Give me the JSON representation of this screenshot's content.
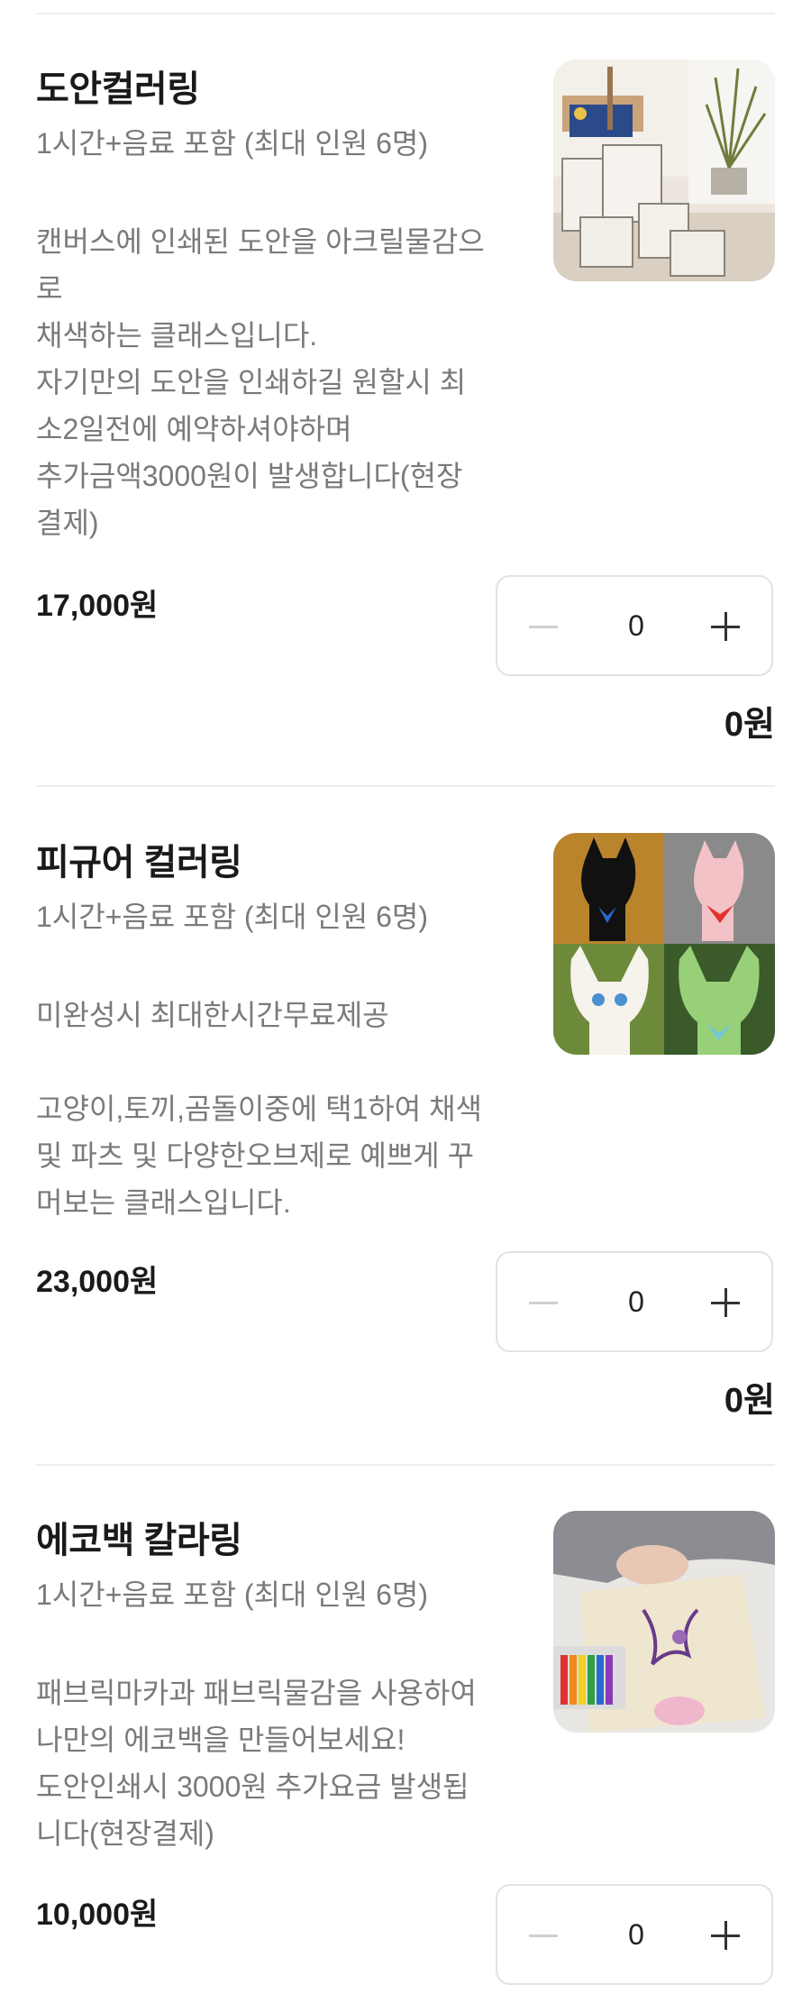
{
  "items": [
    {
      "title": "도안컬러링",
      "subtitle": "1시간+음료 포함 (최대 인원 6명)",
      "description": [
        "캔버스에 인쇄된 도안을 아크릴물감으",
        "로",
        "채색하는 클래스입니다.",
        "자기만의 도안을 인쇄하길 원할시 최",
        "소2일전에 예약하셔야하며",
        "추가금액3000원이 발생합니다(현장",
        "결제)"
      ],
      "image_icon": "easel-and-canvases-photo",
      "price": "17,000원",
      "quantity": "0",
      "total": "0원"
    },
    {
      "title": "피규어 컬러링",
      "subtitle": "1시간+음료 포함 (최대 인원 6명)",
      "description": [
        "미완성시 최대한시간무료제공",
        "",
        "고양이,토끼,곰돌이중에 택1하여 채색",
        "및 파츠 및 다양한오브제로 예쁘게 꾸",
        "머보는 클래스입니다."
      ],
      "image_icon": "painted-cat-figures-photo",
      "price": "23,000원",
      "quantity": "0",
      "total": "0원"
    },
    {
      "title": "에코백 칼라링",
      "subtitle": "1시간+음료 포함 (최대 인원 6명)",
      "description": [
        "패브릭마카과 패브릭물감을 사용하여",
        "나만의 에코백을 만들어보세요!",
        "도안인쇄시 3000원 추가요금 발생됩",
        "니다(현장결제)"
      ],
      "image_icon": "ecobag-painting-photo",
      "price": "10,000원",
      "quantity": "0"
    }
  ],
  "colors": {
    "text_primary": "#1a1a1a",
    "text_secondary": "#7a7a7a",
    "divider": "#eeeeee",
    "stepper_border": "#e2e2e2"
  }
}
